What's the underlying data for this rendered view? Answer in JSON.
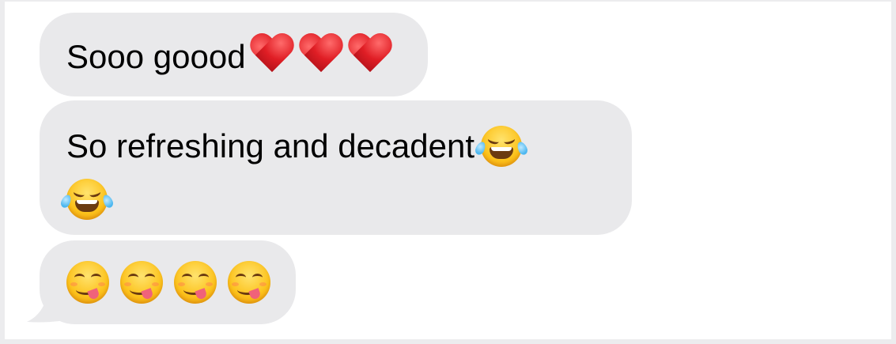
{
  "conversation": {
    "messages": [
      {
        "text": "Sooo goood",
        "emojis": [
          "red-heart",
          "red-heart",
          "red-heart"
        ]
      },
      {
        "text": "So refreshing and decadent",
        "emojis": [
          "face-with-tears-of-joy",
          "face-with-tears-of-joy"
        ]
      },
      {
        "text": "",
        "emojis": [
          "face-savoring-food",
          "face-savoring-food",
          "face-savoring-food",
          "face-savoring-food"
        ]
      }
    ]
  },
  "colors": {
    "bubble_background": "#e9e9eb",
    "text": "#000000",
    "page_background": "#ffffff",
    "heart_red": "#e01e25",
    "emoji_yellow": "#fcc21b"
  }
}
